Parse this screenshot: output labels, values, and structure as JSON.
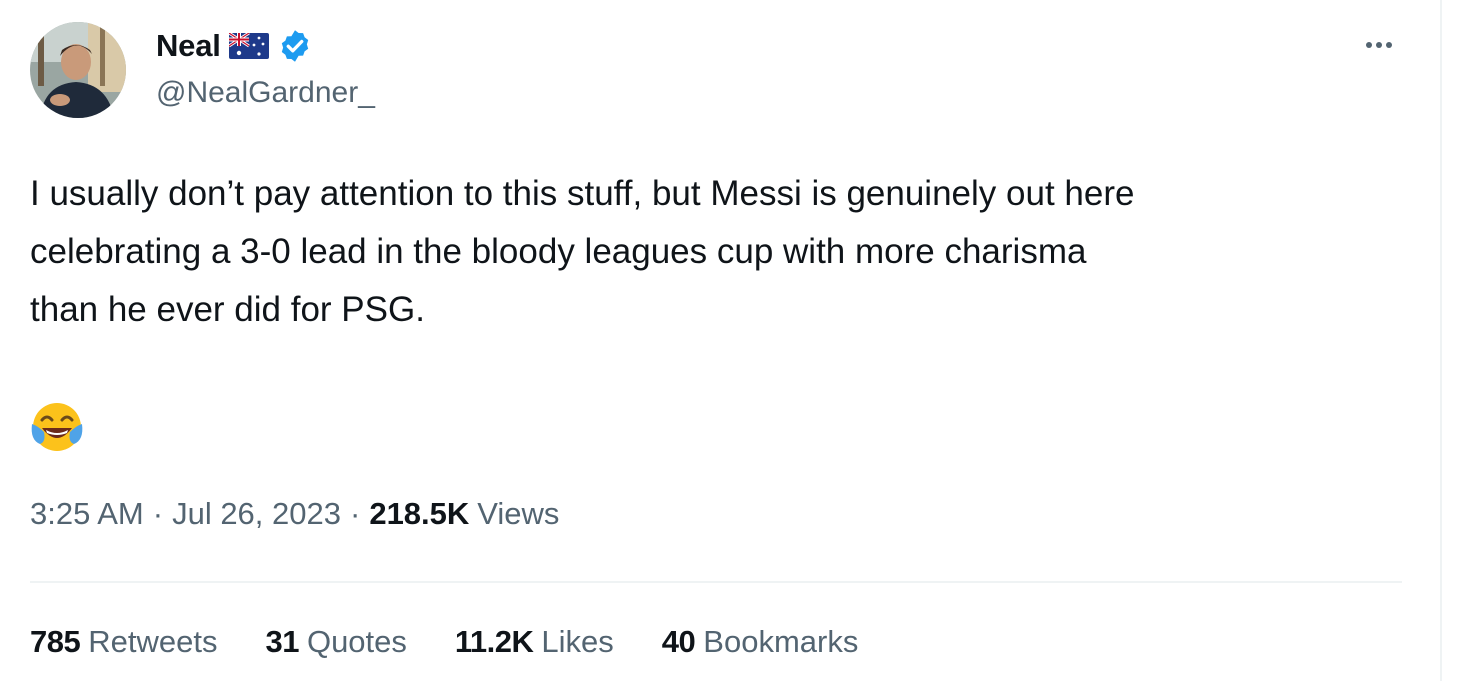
{
  "author": {
    "display_name": "Neal",
    "handle": "@NealGardner_",
    "flag_icon": "australia-flag-icon",
    "verified_icon": "verified-badge-icon"
  },
  "tweet": {
    "text_lines": [
      "I usually don’t pay attention to this stuff, but Messi is genuinely out here",
      "celebrating a 3-0 lead in the bloody leagues cup with more charisma",
      "than he ever did for PSG."
    ],
    "emoji": "face-with-tears-of-joy-icon"
  },
  "meta": {
    "time": "3:25 AM",
    "separator": "·",
    "date": "Jul 26, 2023",
    "views_count": "218.5K",
    "views_label": "Views"
  },
  "stats": [
    {
      "count": "785",
      "label": "Retweets"
    },
    {
      "count": "31",
      "label": "Quotes"
    },
    {
      "count": "11.2K",
      "label": "Likes"
    },
    {
      "count": "40",
      "label": "Bookmarks"
    }
  ],
  "colors": {
    "text_primary": "#0f1419",
    "text_secondary": "#536471",
    "verified_blue": "#1d9bf0",
    "divider": "#eff3f4"
  }
}
